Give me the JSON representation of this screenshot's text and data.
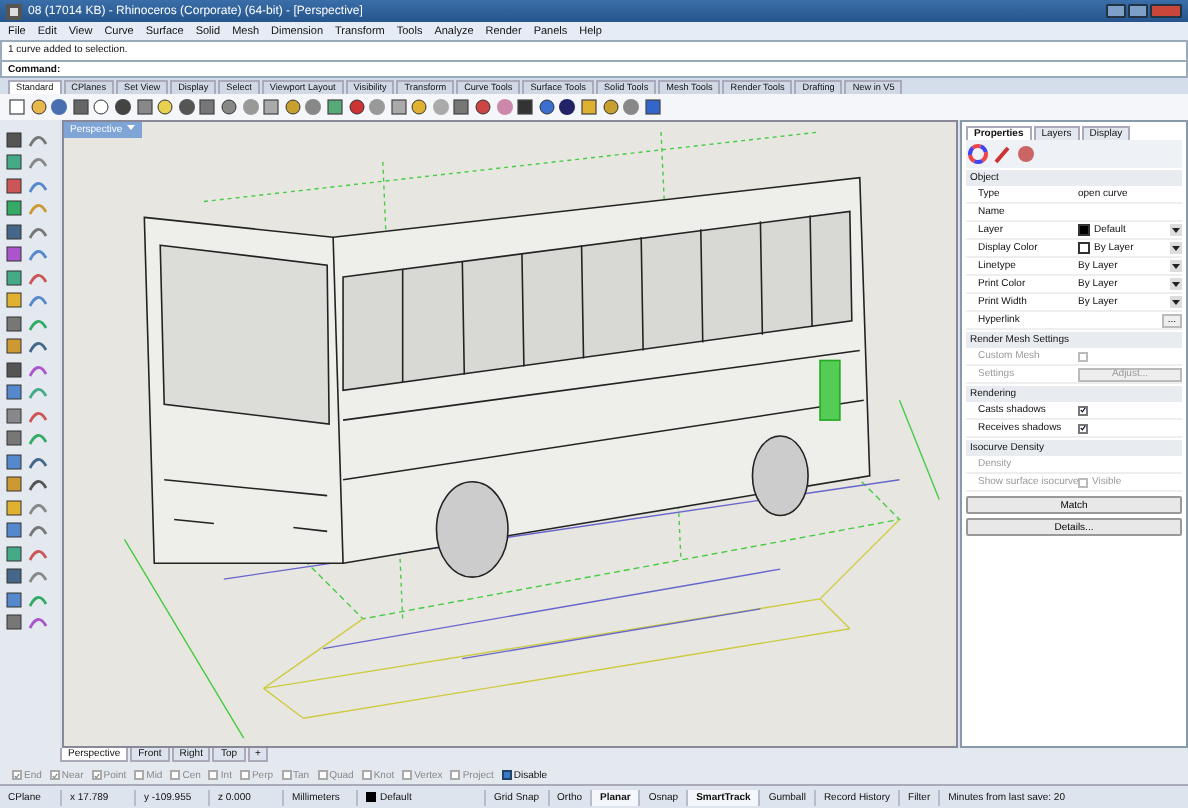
{
  "window": {
    "title": "08 (17014 KB) - Rhinoceros (Corporate) (64-bit) - [Perspective]"
  },
  "menu": [
    "File",
    "Edit",
    "View",
    "Curve",
    "Surface",
    "Solid",
    "Mesh",
    "Dimension",
    "Transform",
    "Tools",
    "Analyze",
    "Render",
    "Panels",
    "Help"
  ],
  "command_history": "1 curve added to selection.",
  "command_prompt": "Command:",
  "toolbar_tabs": [
    {
      "label": "Standard",
      "selected": true
    },
    {
      "label": "CPlanes",
      "selected": false
    },
    {
      "label": "Set View",
      "selected": false
    },
    {
      "label": "Display",
      "selected": false
    },
    {
      "label": "Select",
      "selected": false
    },
    {
      "label": "Viewport Layout",
      "selected": false
    },
    {
      "label": "Visibility",
      "selected": false
    },
    {
      "label": "Transform",
      "selected": false
    },
    {
      "label": "Curve Tools",
      "selected": false
    },
    {
      "label": "Surface Tools",
      "selected": false
    },
    {
      "label": "Solid Tools",
      "selected": false
    },
    {
      "label": "Mesh Tools",
      "selected": false
    },
    {
      "label": "Render Tools",
      "selected": false
    },
    {
      "label": "Drafting",
      "selected": false
    },
    {
      "label": "New in V5",
      "selected": false
    }
  ],
  "viewport": {
    "title": "Perspective"
  },
  "viewport_tabs": [
    {
      "label": "Perspective",
      "selected": true
    },
    {
      "label": "Front",
      "selected": false
    },
    {
      "label": "Right",
      "selected": false
    },
    {
      "label": "Top",
      "selected": false
    },
    {
      "label": "+",
      "selected": false
    }
  ],
  "osnap": [
    {
      "label": "End",
      "checked": true
    },
    {
      "label": "Near",
      "checked": true
    },
    {
      "label": "Point",
      "checked": true
    },
    {
      "label": "Mid",
      "checked": false
    },
    {
      "label": "Cen",
      "checked": false
    },
    {
      "label": "Int",
      "checked": false
    },
    {
      "label": "Perp",
      "checked": false
    },
    {
      "label": "Tan",
      "checked": false
    },
    {
      "label": "Quad",
      "checked": false
    },
    {
      "label": "Knot",
      "checked": false
    },
    {
      "label": "Vertex",
      "checked": false
    },
    {
      "label": "Project",
      "checked": false
    }
  ],
  "osnap_disable": {
    "label": "Disable",
    "checked": true
  },
  "status_bar": {
    "cplane": "CPlane",
    "x": "x 17.789",
    "y": "y -109.955",
    "z": "z 0.000",
    "units": "Millimeters",
    "layer": "Default",
    "toggles": [
      {
        "label": "Grid Snap",
        "on": false
      },
      {
        "label": "Ortho",
        "on": false
      },
      {
        "label": "Planar",
        "on": true
      },
      {
        "label": "Osnap",
        "on": false
      },
      {
        "label": "SmartTrack",
        "on": true
      },
      {
        "label": "Gumball",
        "on": false
      },
      {
        "label": "Record History",
        "on": false
      }
    ],
    "filter": "Filter",
    "save_info": "Minutes from last save: 20"
  },
  "panel": {
    "tabs": [
      {
        "label": "Properties",
        "selected": true
      },
      {
        "label": "Layers",
        "selected": false
      },
      {
        "label": "Display",
        "selected": false
      }
    ],
    "sections": [
      {
        "title": "Object",
        "rows": [
          {
            "kind": "text",
            "label": "Type",
            "value": "open curve"
          },
          {
            "kind": "text",
            "label": "Name"
          },
          {
            "kind": "dropdown",
            "label": "Layer",
            "value": "Default",
            "color": "#000000"
          },
          {
            "kind": "dropdown",
            "label": "Display Color",
            "value": "By Layer",
            "color": "#ffffff"
          },
          {
            "kind": "dropdown",
            "label": "Linetype",
            "value": "By Layer"
          },
          {
            "kind": "dropdown",
            "label": "Print Color",
            "value": "By Layer"
          },
          {
            "kind": "dropdown",
            "label": "Print Width",
            "value": "By Layer"
          },
          {
            "kind": "button",
            "label": "Hyperlink",
            "value": "..."
          }
        ]
      },
      {
        "title": "Render Mesh Settings",
        "rows": [
          {
            "kind": "checkbox",
            "label": "Custom Mesh",
            "checked": false,
            "disabled": true
          },
          {
            "kind": "button",
            "label": "Settings",
            "value": "Adjust...",
            "disabled": true
          }
        ]
      },
      {
        "title": "Rendering",
        "rows": [
          {
            "kind": "checkbox",
            "label": "Casts shadows",
            "checked": true,
            "disabled": false
          },
          {
            "kind": "checkbox",
            "label": "Receives shadows",
            "checked": true,
            "disabled": false
          }
        ]
      },
      {
        "title": "Isocurve Density",
        "rows": [
          {
            "kind": "text",
            "label": "Density",
            "disabled": true
          },
          {
            "kind": "checkbox",
            "label": "Show surface isocurve",
            "value": "Visible",
            "checked": false,
            "disabled": true
          }
        ]
      }
    ],
    "buttons": [
      "Match",
      "Details..."
    ]
  }
}
